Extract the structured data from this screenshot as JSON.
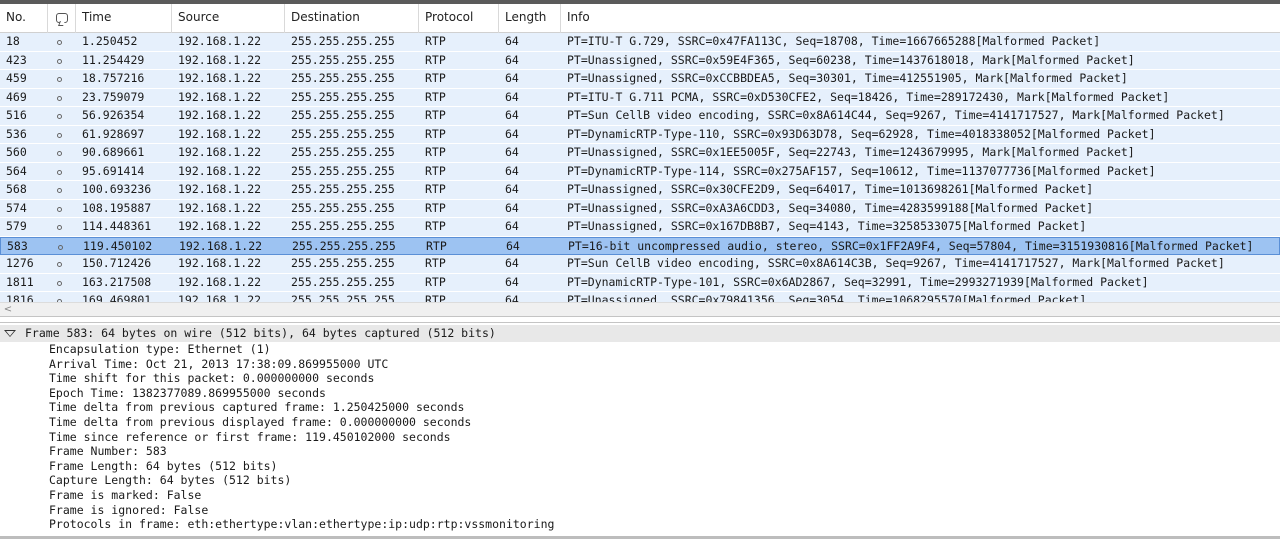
{
  "columns": [
    "No.",
    "",
    "Time",
    "Source",
    "Destination",
    "Protocol",
    "Length",
    "Info"
  ],
  "packets": [
    {
      "no": "18",
      "time": "1.250452",
      "src": "192.168.1.22",
      "dst": "255.255.255.255",
      "proto": "RTP",
      "len": "64",
      "info": "PT=ITU-T G.729, SSRC=0x47FA113C, Seq=18708, Time=1667665288[Malformed Packet]"
    },
    {
      "no": "423",
      "time": "11.254429",
      "src": "192.168.1.22",
      "dst": "255.255.255.255",
      "proto": "RTP",
      "len": "64",
      "info": "PT=Unassigned, SSRC=0x59E4F365, Seq=60238, Time=1437618018, Mark[Malformed Packet]"
    },
    {
      "no": "459",
      "time": "18.757216",
      "src": "192.168.1.22",
      "dst": "255.255.255.255",
      "proto": "RTP",
      "len": "64",
      "info": "PT=Unassigned, SSRC=0xCCBBDEA5, Seq=30301, Time=412551905, Mark[Malformed Packet]"
    },
    {
      "no": "469",
      "time": "23.759079",
      "src": "192.168.1.22",
      "dst": "255.255.255.255",
      "proto": "RTP",
      "len": "64",
      "info": "PT=ITU-T G.711 PCMA, SSRC=0xD530CFE2, Seq=18426, Time=289172430, Mark[Malformed Packet]"
    },
    {
      "no": "516",
      "time": "56.926354",
      "src": "192.168.1.22",
      "dst": "255.255.255.255",
      "proto": "RTP",
      "len": "64",
      "info": "PT=Sun CellB video encoding, SSRC=0x8A614C44, Seq=9267, Time=4141717527, Mark[Malformed Packet]"
    },
    {
      "no": "536",
      "time": "61.928697",
      "src": "192.168.1.22",
      "dst": "255.255.255.255",
      "proto": "RTP",
      "len": "64",
      "info": "PT=DynamicRTP-Type-110, SSRC=0x93D63D78, Seq=62928, Time=4018338052[Malformed Packet]"
    },
    {
      "no": "560",
      "time": "90.689661",
      "src": "192.168.1.22",
      "dst": "255.255.255.255",
      "proto": "RTP",
      "len": "64",
      "info": "PT=Unassigned, SSRC=0x1EE5005F, Seq=22743, Time=1243679995, Mark[Malformed Packet]"
    },
    {
      "no": "564",
      "time": "95.691414",
      "src": "192.168.1.22",
      "dst": "255.255.255.255",
      "proto": "RTP",
      "len": "64",
      "info": "PT=DynamicRTP-Type-114, SSRC=0x275AF157, Seq=10612, Time=1137077736[Malformed Packet]"
    },
    {
      "no": "568",
      "time": "100.693236",
      "src": "192.168.1.22",
      "dst": "255.255.255.255",
      "proto": "RTP",
      "len": "64",
      "info": "PT=Unassigned, SSRC=0x30CFE2D9, Seq=64017, Time=1013698261[Malformed Packet]"
    },
    {
      "no": "574",
      "time": "108.195887",
      "src": "192.168.1.22",
      "dst": "255.255.255.255",
      "proto": "RTP",
      "len": "64",
      "info": "PT=Unassigned, SSRC=0xA3A6CDD3, Seq=34080, Time=4283599188[Malformed Packet]"
    },
    {
      "no": "579",
      "time": "114.448361",
      "src": "192.168.1.22",
      "dst": "255.255.255.255",
      "proto": "RTP",
      "len": "64",
      "info": "PT=Unassigned, SSRC=0x167DB8B7, Seq=4143, Time=3258533075[Malformed Packet]"
    },
    {
      "no": "583",
      "time": "119.450102",
      "src": "192.168.1.22",
      "dst": "255.255.255.255",
      "proto": "RTP",
      "len": "64",
      "info": "PT=16-bit uncompressed audio, stereo, SSRC=0x1FF2A9F4, Seq=57804, Time=3151930816[Malformed Packet]",
      "selected": true
    },
    {
      "no": "1276",
      "time": "150.712426",
      "src": "192.168.1.22",
      "dst": "255.255.255.255",
      "proto": "RTP",
      "len": "64",
      "info": "PT=Sun CellB video encoding, SSRC=0x8A614C3B, Seq=9267, Time=4141717527, Mark[Malformed Packet]"
    },
    {
      "no": "1811",
      "time": "163.217508",
      "src": "192.168.1.22",
      "dst": "255.255.255.255",
      "proto": "RTP",
      "len": "64",
      "info": "PT=DynamicRTP-Type-101, SSRC=0x6AD2867, Seq=32991, Time=2993271939[Malformed Packet]"
    },
    {
      "no": "1816",
      "time": "169.469801",
      "src": "192.168.1.22",
      "dst": "255.255.255.255",
      "proto": "RTP",
      "len": "64",
      "info": "PT=Unassigned, SSRC=0x79841356, Seq=3054, Time=1068295570[Malformed Packet]"
    }
  ],
  "details": {
    "frame_summary": "Frame 583: 64 bytes on wire (512 bits), 64 bytes captured (512 bits)",
    "lines": [
      "Encapsulation type: Ethernet (1)",
      "Arrival Time: Oct 21, 2013 17:38:09.869955000 UTC",
      "Time shift for this packet: 0.000000000 seconds",
      "Epoch Time: 1382377089.869955000 seconds",
      "Time delta from previous captured frame: 1.250425000 seconds",
      "Time delta from previous displayed frame: 0.000000000 seconds",
      "Time since reference or first frame: 119.450102000 seconds",
      "Frame Number: 583",
      "Frame Length: 64 bytes (512 bits)",
      "Capture Length: 64 bytes (512 bits)",
      "Frame is marked: False",
      "Frame is ignored: False",
      "Protocols in frame: eth:ethertype:vlan:ethertype:ip:udp:rtp:vssmonitoring"
    ]
  },
  "icons": {
    "comment_column": "comment-icon",
    "packet_marker": "dot-icon",
    "scroll_left": "chevron-left-icon",
    "expand": "triangle-down-icon"
  },
  "colors": {
    "row_bg": "#e6f0fc",
    "selected_bg": "#9dc3f2",
    "selected_border": "#5a8fd6"
  }
}
